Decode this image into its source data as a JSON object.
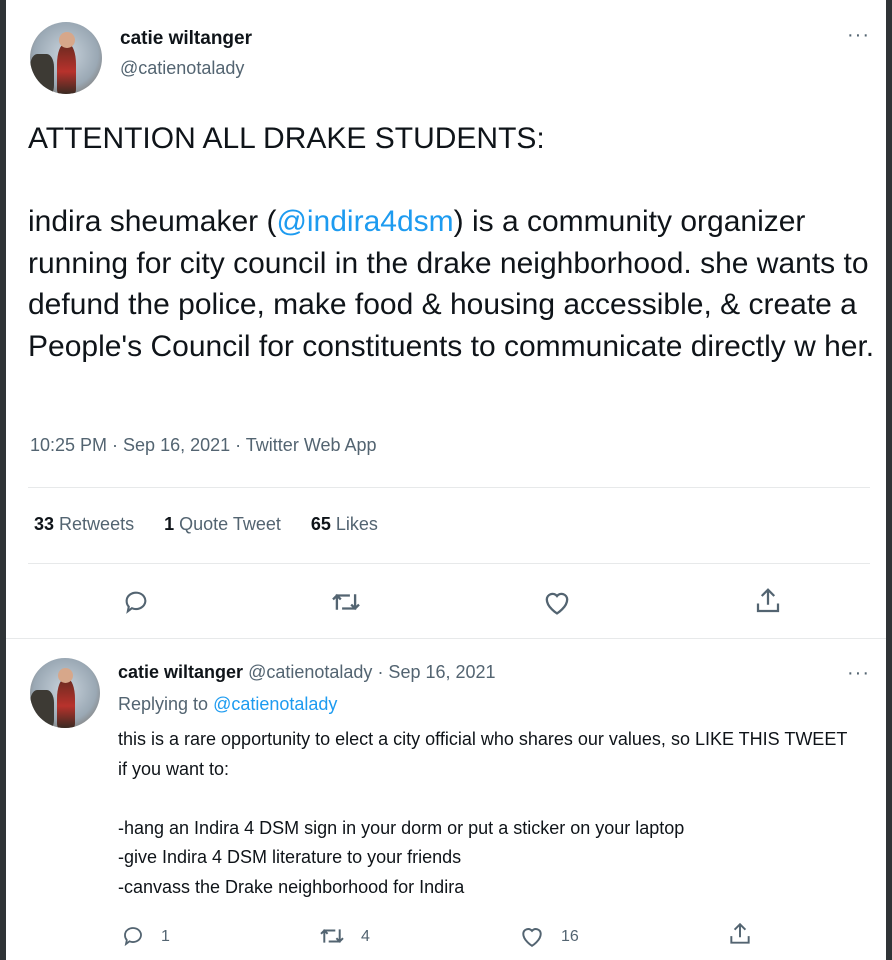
{
  "tweet": {
    "author_name": "catie wiltanger",
    "author_handle": "@catienotalady",
    "more_label": "···",
    "heading": "ATTENTION ALL DRAKE STUDENTS:",
    "text_before_mention": "indira sheumaker (",
    "mention": "@indira4dsm",
    "text_after_mention": ") is a community organizer running for city council in the drake neighborhood. she wants to defund the police, make food & housing accessible, & create a People's Council for constituents to communicate directly w her.",
    "meta": "10:25 PM · Sep 16, 2021 · Twitter Web App",
    "stats": {
      "retweets_count": "33",
      "retweets_label": "Retweets",
      "quotes_count": "1",
      "quotes_label": "Quote Tweet",
      "likes_count": "65",
      "likes_label": "Likes"
    },
    "actions": [
      "reply-icon",
      "retweet-icon",
      "like-icon",
      "share-icon"
    ]
  },
  "reply": {
    "author_name": "catie wiltanger",
    "author_handle": "@catienotalady",
    "date": "· Sep 16, 2021",
    "more_label": "···",
    "replying_prefix": "Replying to",
    "replying_handle": "@catienotalady",
    "text": "this is a rare opportunity to elect a city official who shares our values, so LIKE THIS TWEET if you want to:\n\n-hang an Indira 4 DSM sign in your dorm or put a sticker on your laptop\n-give Indira 4 DSM literature to your friends\n-canvass the Drake neighborhood for Indira",
    "reply_count": "1",
    "retweet_count": "4",
    "like_count": "16"
  },
  "colors": {
    "accent": "#1d9bf0",
    "muted_text": "#536471",
    "text": "#0f1419",
    "divider": "#e7e9ea"
  }
}
